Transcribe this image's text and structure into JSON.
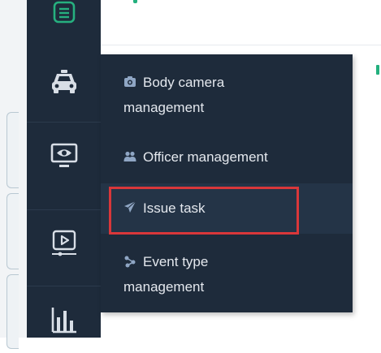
{
  "menu": {
    "items": [
      {
        "line1": "Body camera",
        "line2": "management",
        "icon": "camera-icon"
      },
      {
        "line1": "Officer management",
        "icon": "group-icon"
      },
      {
        "line1": "Issue task",
        "icon": "send-icon"
      },
      {
        "line1": "Event type",
        "line2": "management",
        "icon": "connection-icon"
      }
    ]
  },
  "sidebar": {
    "icons": [
      "list-icon",
      "car-icon",
      "monitor-eye-icon",
      "video-play-icon",
      "chart-icon"
    ]
  },
  "colors": {
    "sidebar_bg": "#1e2b3b",
    "menu_text": "#e4e8ee",
    "accent_green": "#23b07e",
    "highlight_red": "#d9373a"
  }
}
